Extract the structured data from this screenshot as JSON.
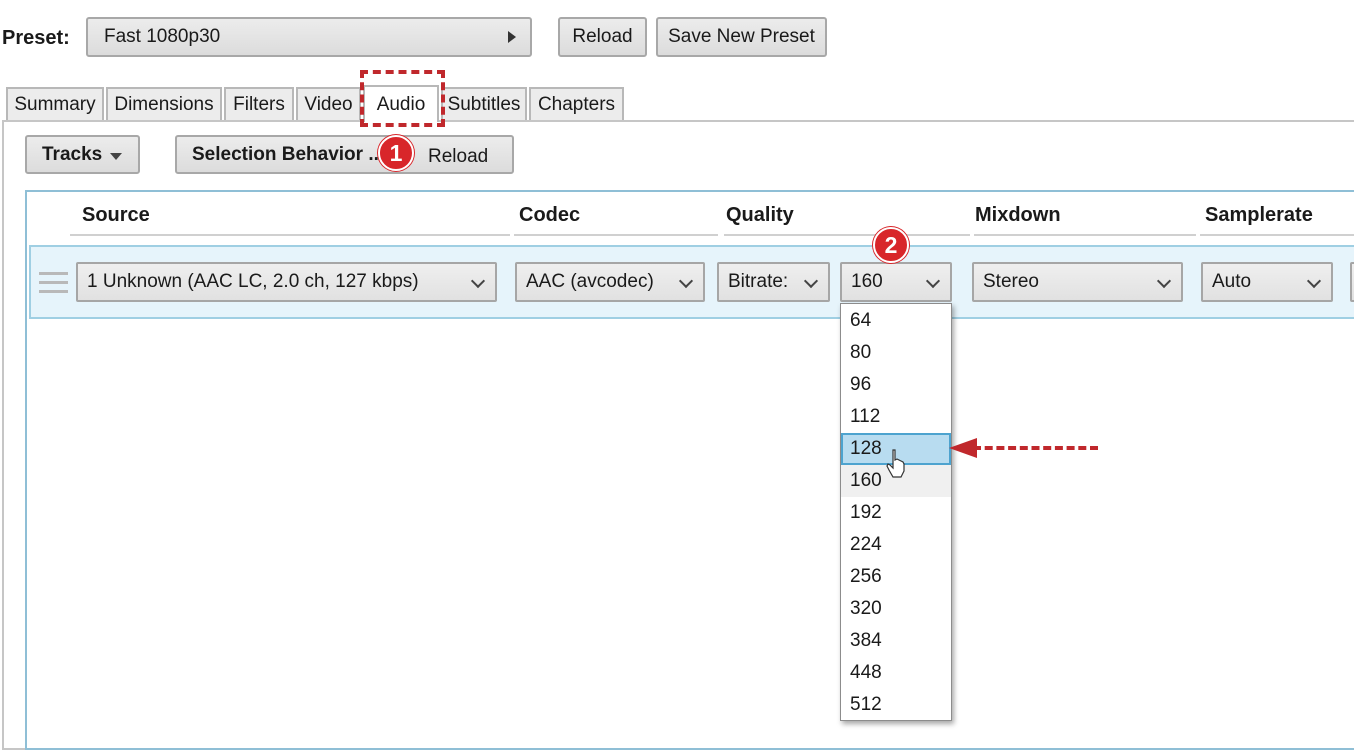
{
  "preset": {
    "label": "Preset:",
    "value": "Fast 1080p30",
    "reload": "Reload",
    "save_new": "Save New Preset"
  },
  "tabs": [
    {
      "label": "Summary"
    },
    {
      "label": "Dimensions"
    },
    {
      "label": "Filters"
    },
    {
      "label": "Video"
    },
    {
      "label": "Audio"
    },
    {
      "label": "Subtitles"
    },
    {
      "label": "Chapters"
    }
  ],
  "active_tab": "Audio",
  "toolbar": {
    "tracks": "Tracks",
    "selection_behavior": "Selection Behavior ...",
    "reload": "Reload"
  },
  "columns": {
    "source": "Source",
    "codec": "Codec",
    "quality": "Quality",
    "mixdown": "Mixdown",
    "samplerate": "Samplerate"
  },
  "track": {
    "source": "1 Unknown (AAC LC, 2.0 ch, 127 kbps)",
    "codec": "AAC (avcodec)",
    "quality_mode": "Bitrate:",
    "bitrate": "160",
    "mixdown": "Stereo",
    "samplerate": "Auto"
  },
  "bitrate_options": [
    "64",
    "80",
    "96",
    "112",
    "128",
    "160",
    "192",
    "224",
    "256",
    "320",
    "384",
    "448",
    "512"
  ],
  "highlighted_option": "128",
  "current_option": "160",
  "annotations": {
    "step1": "1",
    "step2": "2",
    "color": "#c0282c"
  },
  "colors": {
    "highlight": "#b8dcf0",
    "row_bg": "#e6f4fb"
  }
}
